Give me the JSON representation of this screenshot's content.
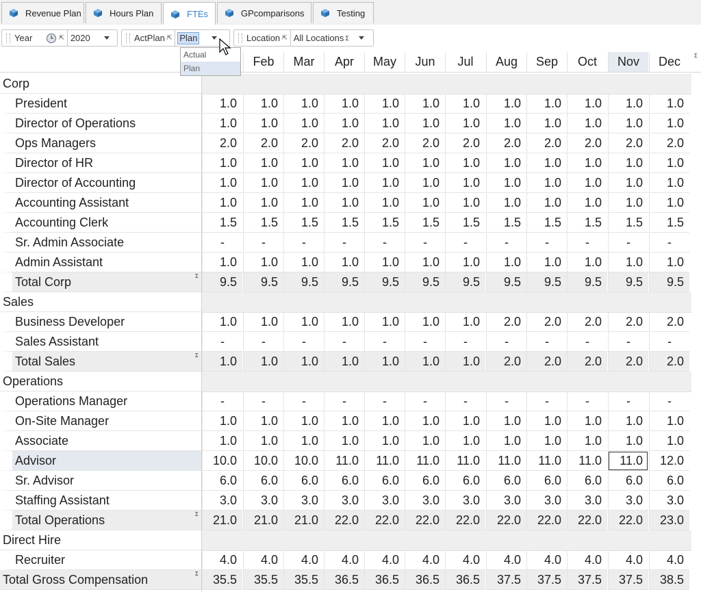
{
  "tabs": [
    {
      "label": "Revenue Plan",
      "active": false
    },
    {
      "label": "Hours Plan",
      "active": false
    },
    {
      "label": "FTEs",
      "active": true
    },
    {
      "label": "GPcomparisons",
      "active": false
    },
    {
      "label": "Testing",
      "active": false
    }
  ],
  "filters": {
    "year_label": "Year",
    "year_value": "2020",
    "actplan_label": "ActPlan",
    "actplan_value": "Plan",
    "location_label": "Location",
    "location_value": "All Locations"
  },
  "dropdown": {
    "options": [
      "Actual",
      "Plan"
    ],
    "selected": "Plan"
  },
  "months": [
    "Feb",
    "Mar",
    "Apr",
    "May",
    "Jun",
    "Jul",
    "Aug",
    "Sep",
    "Oct",
    "Nov",
    "Dec"
  ],
  "highlighted_month": "Nov",
  "rows": [
    {
      "type": "section",
      "label": "Corp"
    },
    {
      "type": "data",
      "label": "President",
      "values": [
        "1.0",
        "1.0",
        "1.0",
        "1.0",
        "1.0",
        "1.0",
        "1.0",
        "1.0",
        "1.0",
        "1.0",
        "1.0",
        "1.0"
      ]
    },
    {
      "type": "data",
      "label": "Director of Operations",
      "values": [
        "1.0",
        "1.0",
        "1.0",
        "1.0",
        "1.0",
        "1.0",
        "1.0",
        "1.0",
        "1.0",
        "1.0",
        "1.0",
        "1.0"
      ]
    },
    {
      "type": "data",
      "label": "Ops Managers",
      "values": [
        "2.0",
        "2.0",
        "2.0",
        "2.0",
        "2.0",
        "2.0",
        "2.0",
        "2.0",
        "2.0",
        "2.0",
        "2.0",
        "2.0"
      ]
    },
    {
      "type": "data",
      "label": "Director of HR",
      "values": [
        "1.0",
        "1.0",
        "1.0",
        "1.0",
        "1.0",
        "1.0",
        "1.0",
        "1.0",
        "1.0",
        "1.0",
        "1.0",
        "1.0"
      ]
    },
    {
      "type": "data",
      "label": "Director of Accounting",
      "values": [
        "1.0",
        "1.0",
        "1.0",
        "1.0",
        "1.0",
        "1.0",
        "1.0",
        "1.0",
        "1.0",
        "1.0",
        "1.0",
        "1.0"
      ]
    },
    {
      "type": "data",
      "label": "Accounting Assistant",
      "values": [
        "1.0",
        "1.0",
        "1.0",
        "1.0",
        "1.0",
        "1.0",
        "1.0",
        "1.0",
        "1.0",
        "1.0",
        "1.0",
        "1.0"
      ]
    },
    {
      "type": "data",
      "label": "Accounting Clerk",
      "values": [
        "1.5",
        "1.5",
        "1.5",
        "1.5",
        "1.5",
        "1.5",
        "1.5",
        "1.5",
        "1.5",
        "1.5",
        "1.5",
        "1.5"
      ]
    },
    {
      "type": "data",
      "label": "Sr. Admin Associate",
      "values": [
        "-",
        "-",
        "-",
        "-",
        "-",
        "-",
        "-",
        "-",
        "-",
        "-",
        "-",
        "-"
      ]
    },
    {
      "type": "data",
      "label": "Admin Assistant",
      "values": [
        "1.0",
        "1.0",
        "1.0",
        "1.0",
        "1.0",
        "1.0",
        "1.0",
        "1.0",
        "1.0",
        "1.0",
        "1.0",
        "1.0"
      ]
    },
    {
      "type": "total",
      "label": "Total Corp",
      "values": [
        "9.5",
        "9.5",
        "9.5",
        "9.5",
        "9.5",
        "9.5",
        "9.5",
        "9.5",
        "9.5",
        "9.5",
        "9.5",
        "9.5"
      ]
    },
    {
      "type": "section",
      "label": "Sales"
    },
    {
      "type": "data",
      "label": "Business Developer",
      "values": [
        "1.0",
        "1.0",
        "1.0",
        "1.0",
        "1.0",
        "1.0",
        "1.0",
        "2.0",
        "2.0",
        "2.0",
        "2.0",
        "2.0"
      ]
    },
    {
      "type": "data",
      "label": "Sales Assistant",
      "values": [
        "-",
        "-",
        "-",
        "-",
        "-",
        "-",
        "-",
        "-",
        "-",
        "-",
        "-",
        "-"
      ]
    },
    {
      "type": "total",
      "label": "Total Sales",
      "values": [
        "1.0",
        "1.0",
        "1.0",
        "1.0",
        "1.0",
        "1.0",
        "1.0",
        "2.0",
        "2.0",
        "2.0",
        "2.0",
        "2.0"
      ]
    },
    {
      "type": "section",
      "label": "Operations"
    },
    {
      "type": "data",
      "label": "Operations Manager",
      "values": [
        "-",
        "-",
        "-",
        "-",
        "-",
        "-",
        "-",
        "-",
        "-",
        "-",
        "-",
        "-"
      ]
    },
    {
      "type": "data",
      "label": "On-Site Manager",
      "values": [
        "1.0",
        "1.0",
        "1.0",
        "1.0",
        "1.0",
        "1.0",
        "1.0",
        "1.0",
        "1.0",
        "1.0",
        "1.0",
        "1.0"
      ]
    },
    {
      "type": "data",
      "label": "Associate",
      "values": [
        "1.0",
        "1.0",
        "1.0",
        "1.0",
        "1.0",
        "1.0",
        "1.0",
        "1.0",
        "1.0",
        "1.0",
        "1.0",
        "1.0"
      ]
    },
    {
      "type": "data",
      "label": "Advisor",
      "selected": true,
      "values": [
        "10.0",
        "10.0",
        "10.0",
        "11.0",
        "11.0",
        "11.0",
        "11.0",
        "11.0",
        "11.0",
        "11.0",
        "11.0",
        "12.0"
      ]
    },
    {
      "type": "data",
      "label": "Sr. Advisor",
      "values": [
        "6.0",
        "6.0",
        "6.0",
        "6.0",
        "6.0",
        "6.0",
        "6.0",
        "6.0",
        "6.0",
        "6.0",
        "6.0",
        "6.0"
      ]
    },
    {
      "type": "data",
      "label": "Staffing Assistant",
      "values": [
        "3.0",
        "3.0",
        "3.0",
        "3.0",
        "3.0",
        "3.0",
        "3.0",
        "3.0",
        "3.0",
        "3.0",
        "3.0",
        "3.0"
      ]
    },
    {
      "type": "total",
      "label": "Total Operations",
      "values": [
        "21.0",
        "21.0",
        "21.0",
        "22.0",
        "22.0",
        "22.0",
        "22.0",
        "22.0",
        "22.0",
        "22.0",
        "22.0",
        "23.0"
      ]
    },
    {
      "type": "section",
      "label": "Direct Hire"
    },
    {
      "type": "data",
      "label": "Recruiter",
      "values": [
        "4.0",
        "4.0",
        "4.0",
        "4.0",
        "4.0",
        "4.0",
        "4.0",
        "4.0",
        "4.0",
        "4.0",
        "4.0",
        "4.0"
      ]
    },
    {
      "type": "grandtotal",
      "label": "Total Gross Compensation",
      "values": [
        "35.5",
        "35.5",
        "35.5",
        "36.5",
        "36.5",
        "36.5",
        "36.5",
        "37.5",
        "37.5",
        "37.5",
        "37.5",
        "38.5"
      ]
    }
  ],
  "colors": {
    "accent": "#3a7fd0",
    "total_bg": "#ededed",
    "section_bg": "#efefef",
    "selected_bg": "#e4e9f0"
  }
}
